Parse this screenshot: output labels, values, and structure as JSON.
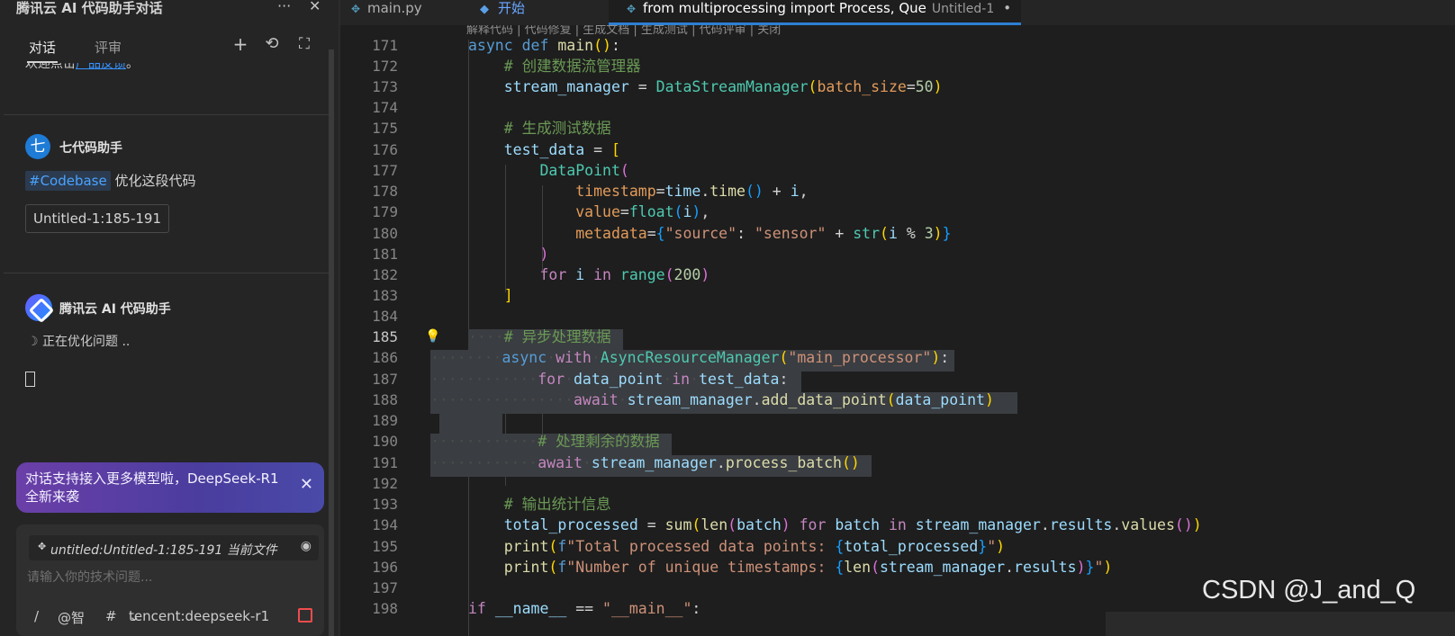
{
  "left_panel": {
    "title": "腾讯云 AI 代码助手对话",
    "more_icon": "···",
    "close_icon": "✕",
    "tabs": [
      {
        "label": "对话",
        "active": true
      },
      {
        "label": "评审",
        "active": false
      }
    ],
    "tools": {
      "add": "+",
      "history": "⟲",
      "expand": "⛶"
    },
    "clipped_text": "欢迎点击",
    "clipped_link": "产品反馈",
    "clipped_tail": "。",
    "user": {
      "avatar_char": "七",
      "name": "七代码助手"
    },
    "message": {
      "tag": "#Codebase",
      "text": "优化这段代码"
    },
    "file_chip": "Untitled-1:185-191",
    "bot": {
      "name": "腾讯云 AI 代码助手",
      "status": "正在优化问题 .."
    },
    "promo": {
      "text": "对话支持接入更多模型啦，DeepSeek-R1 全新来袭",
      "close": "✕"
    },
    "input": {
      "context_label": "untitled:Untitled-1:185-191 当前文件",
      "placeholder": "请输入你的技术问题...",
      "tools": {
        "slash": "/",
        "at": "@智",
        "hash": "#",
        "model": "tencent:deepseek-r1"
      }
    }
  },
  "editor_tabs": [
    {
      "label": "main.py",
      "icon": "python-icon",
      "active": false
    },
    {
      "label": "开始",
      "icon": "vscode-icon",
      "active": false
    },
    {
      "label": "from multiprocessing import Process, Que",
      "sub": "Untitled-1",
      "dirty": "•",
      "icon": "python-icon",
      "active": true
    }
  ],
  "editor": {
    "codelens": "解释代码 | 代码修复 | 生成文档 | 生成测试 | 代码评审 | 关闭",
    "line_numbers": [
      "171",
      "172",
      "173",
      "174",
      "175",
      "176",
      "177",
      "178",
      "179",
      "180",
      "181",
      "182",
      "183",
      "184",
      "185",
      "186",
      "187",
      "188",
      "189",
      "190",
      "191",
      "192",
      "193",
      "194",
      "195",
      "196",
      "197",
      "198"
    ],
    "current_line": "185",
    "colors": {
      "background": "#1e1e1e",
      "selection": "#3a3d41",
      "accent": "#2d7fd3"
    }
  },
  "watermark": "CSDN @J_and_Q"
}
